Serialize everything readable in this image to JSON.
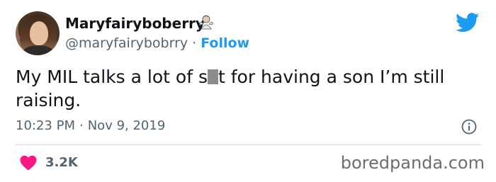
{
  "author": {
    "display_name": "Maryfairyboberry",
    "handle": "@maryfairybobrry",
    "separator": "·",
    "follow_label": "Follow",
    "badge_icon": "fairy-emoji-icon"
  },
  "tweet": {
    "text_before_censor": "My MIL talks a lot of s",
    "text_after_censor": "t for having a son I’m still raising.",
    "time": "10:23 PM",
    "separator": "·",
    "date": "Nov 9, 2019"
  },
  "engagement": {
    "likes": "3.2K"
  },
  "watermark": "boredpanda.com",
  "colors": {
    "twitter_blue": "#1d9bf0",
    "like_pink": "#f91880",
    "secondary_text": "#536471",
    "divider": "#cfd9de"
  }
}
